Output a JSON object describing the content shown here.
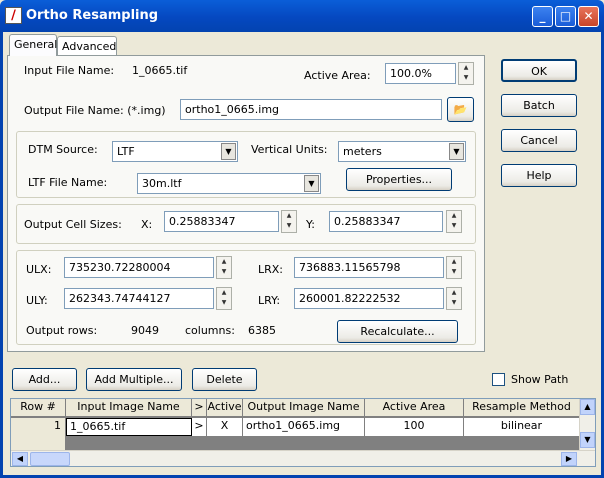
{
  "window": {
    "title": "Ortho Resampling",
    "title_icon": "ortho-app-icon",
    "controls": {
      "minimize": "_",
      "maximize": "□",
      "close": "✕"
    }
  },
  "tabs": [
    {
      "label": "General",
      "active": true
    },
    {
      "label": "Advanced",
      "active": false
    }
  ],
  "general": {
    "input_file_label": "Input File Name:",
    "input_file_value": "1_0665.tif",
    "active_area_label": "Active Area:",
    "active_area_value": "100.0%",
    "output_file_label": "Output File Name: (*.img)",
    "output_file_value": "ortho1_0665.img",
    "dtm_source_label": "DTM Source:",
    "dtm_source_value": "LTF",
    "vertical_units_label": "Vertical Units:",
    "vertical_units_value": "meters",
    "ltf_file_label": "LTF File Name:",
    "ltf_file_value": "30m.ltf",
    "properties_button": "Properties...",
    "cell_sizes_label": "Output Cell Sizes:",
    "x_label": "X:",
    "x_value": "0.25883347",
    "y_label": "Y:",
    "y_value": "0.25883347",
    "ulx_label": "ULX:",
    "ulx_value": "735230.72280004",
    "lrx_label": "LRX:",
    "lrx_value": "736883.11565798",
    "uly_label": "ULY:",
    "uly_value": "262343.74744127",
    "lry_label": "LRY:",
    "lry_value": "260001.82222532",
    "rows_label": "Output rows:",
    "rows_value": "9049",
    "columns_label": "columns:",
    "columns_value": "6385",
    "recalc_button": "Recalculate..."
  },
  "side_buttons": {
    "ok": "OK",
    "batch": "Batch",
    "cancel": "Cancel",
    "help": "Help"
  },
  "list_buttons": {
    "add": "Add...",
    "add_multiple": "Add Multiple...",
    "delete": "Delete"
  },
  "show_path": {
    "label": "Show Path",
    "checked": false
  },
  "table": {
    "headers": [
      "Row #",
      "Input Image Name",
      ">",
      "Active",
      "Output Image Name",
      "Active Area",
      "Resample Method"
    ],
    "rows": [
      [
        "1",
        "1_0665.tif",
        ">",
        "X",
        "ortho1_0665.img",
        "100",
        "bilinear"
      ]
    ]
  },
  "colors": {
    "titlebar": "#0548c0",
    "face": "#ece9d8"
  }
}
